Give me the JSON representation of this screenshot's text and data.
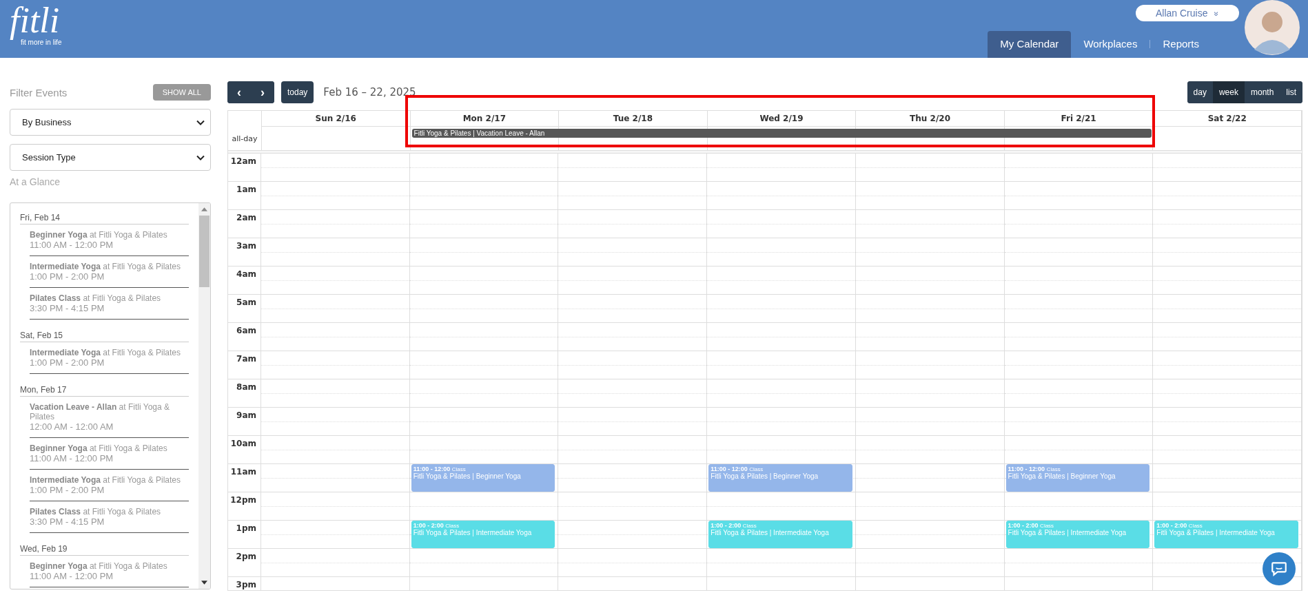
{
  "logo": {
    "wordmark": "fitli",
    "tagline": "fit more in life"
  },
  "user": {
    "name": "Allan Cruise",
    "caret": "»"
  },
  "nav": [
    {
      "label": "My Calendar",
      "selected": true
    },
    {
      "label": "Workplaces",
      "selected": false
    },
    {
      "label": "Reports",
      "selected": false
    }
  ],
  "sidebar": {
    "filter_title": "Filter Events",
    "show_all": "SHOW ALL",
    "selects": [
      "By Business",
      "Session Type"
    ],
    "glance_title": "At a Glance",
    "groups": [
      {
        "date": "Fri, Feb 14",
        "items": [
          {
            "title": "**Beginner Yoga** at Fitli Yoga & Pilates",
            "time": "11:00 AM - 12:00 PM"
          },
          {
            "title": "**Intermediate Yoga** at Fitli Yoga & Pilates",
            "time": "1:00 PM - 2:00 PM"
          },
          {
            "title": "**Pilates Class** at Fitli Yoga & Pilates",
            "time": "3:30 PM - 4:15 PM"
          }
        ]
      },
      {
        "date": "Sat, Feb 15",
        "items": [
          {
            "title": "**Intermediate Yoga** at Fitli Yoga & Pilates",
            "time": "1:00 PM - 2:00 PM"
          }
        ]
      },
      {
        "date": "Mon, Feb 17",
        "items": [
          {
            "title": "**Vacation Leave - Allan** at Fitli Yoga & Pilates",
            "time": "12:00 AM - 12:00 AM"
          },
          {
            "title": "**Beginner Yoga** at Fitli Yoga & Pilates",
            "time": "11:00 AM - 12:00 PM"
          },
          {
            "title": "**Intermediate Yoga** at Fitli Yoga & Pilates",
            "time": "1:00 PM - 2:00 PM"
          },
          {
            "title": "**Pilates Class** at Fitli Yoga & Pilates",
            "time": "3:30 PM - 4:15 PM"
          }
        ]
      },
      {
        "date": "Wed, Feb 19",
        "items": [
          {
            "title": "**Beginner Yoga** at Fitli Yoga & Pilates",
            "time": "11:00 AM - 12:00 PM"
          }
        ]
      }
    ]
  },
  "toolbar": {
    "prev": "‹",
    "next": "›",
    "today": "today",
    "range": "Feb 16 – 22, 2025",
    "views": [
      {
        "label": "day",
        "selected": false
      },
      {
        "label": "week",
        "selected": true
      },
      {
        "label": "month",
        "selected": false
      },
      {
        "label": "list",
        "selected": false
      }
    ]
  },
  "calendar": {
    "all_day_label": "all-day",
    "all_day_event": {
      "text": "Fitli Yoga & Pilates | Vacation Leave - Allan"
    },
    "days": [
      {
        "label": "Sun 2/16",
        "in_all_day_event": false
      },
      {
        "label": "Mon 2/17",
        "in_all_day_event": true
      },
      {
        "label": "Tue 2/18",
        "in_all_day_event": true
      },
      {
        "label": "Wed 2/19",
        "in_all_day_event": true
      },
      {
        "label": "Thu 2/20",
        "in_all_day_event": true
      },
      {
        "label": "Fri 2/21",
        "in_all_day_event": true
      },
      {
        "label": "Sat 2/22",
        "in_all_day_event": false
      }
    ],
    "hours": [
      {
        "label": "12am"
      },
      {
        "label": "1am"
      },
      {
        "label": "2am"
      },
      {
        "label": "3am"
      },
      {
        "label": "4am"
      },
      {
        "label": "5am"
      },
      {
        "label": "6am"
      },
      {
        "label": "7am"
      },
      {
        "label": "8am"
      },
      {
        "label": "9am"
      },
      {
        "label": "10am"
      },
      {
        "label": "11am",
        "cells": [
          null,
          {
            "time": "11:00 - 12:00",
            "type": "Class",
            "title": "Fitli Yoga & Pilates | Beginner Yoga",
            "color": "#94b6ea"
          },
          null,
          {
            "time": "11:00 - 12:00",
            "type": "Class",
            "title": "Fitli Yoga & Pilates | Beginner Yoga",
            "color": "#94b6ea"
          },
          null,
          {
            "time": "11:00 - 12:00",
            "type": "Class",
            "title": "Fitli Yoga & Pilates | Beginner Yoga",
            "color": "#94b6ea"
          },
          null
        ]
      },
      {
        "label": "12pm"
      },
      {
        "label": "1pm",
        "cells": [
          null,
          {
            "time": "1:00 - 2:00",
            "type": "Class",
            "title": "Fitli Yoga & Pilates | Intermediate Yoga",
            "color": "#5adde6"
          },
          null,
          {
            "time": "1:00 - 2:00",
            "type": "Class",
            "title": "Fitli Yoga & Pilates | Intermediate Yoga",
            "color": "#5adde6"
          },
          null,
          {
            "time": "1:00 - 2:00",
            "type": "Class",
            "title": "Fitli Yoga & Pilates | Intermediate Yoga",
            "color": "#5adde6"
          },
          {
            "time": "1:00 - 2:00",
            "type": "Class",
            "title": "Fitli Yoga & Pilates | Intermediate Yoga",
            "color": "#5adde6"
          }
        ]
      },
      {
        "label": "2pm"
      },
      {
        "label": "3pm"
      }
    ]
  }
}
